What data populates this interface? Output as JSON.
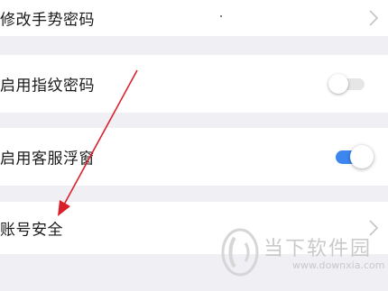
{
  "settings": {
    "items": [
      {
        "label": "修改手势密码",
        "control": "chevron"
      },
      {
        "label": "启用指纹密码",
        "control": "toggle",
        "enabled": false
      },
      {
        "label": "启用客服浮窗",
        "control": "toggle",
        "enabled": true
      },
      {
        "label": "账号安全",
        "control": "chevron"
      }
    ]
  },
  "watermark": {
    "name": "当下软件园",
    "url": "www.downxia.com"
  },
  "colors": {
    "background": "#efeff4",
    "row": "#ffffff",
    "toggle_on": "#3d86f0",
    "toggle_off": "#e6e6e6",
    "annotation_arrow": "#d9202a"
  }
}
